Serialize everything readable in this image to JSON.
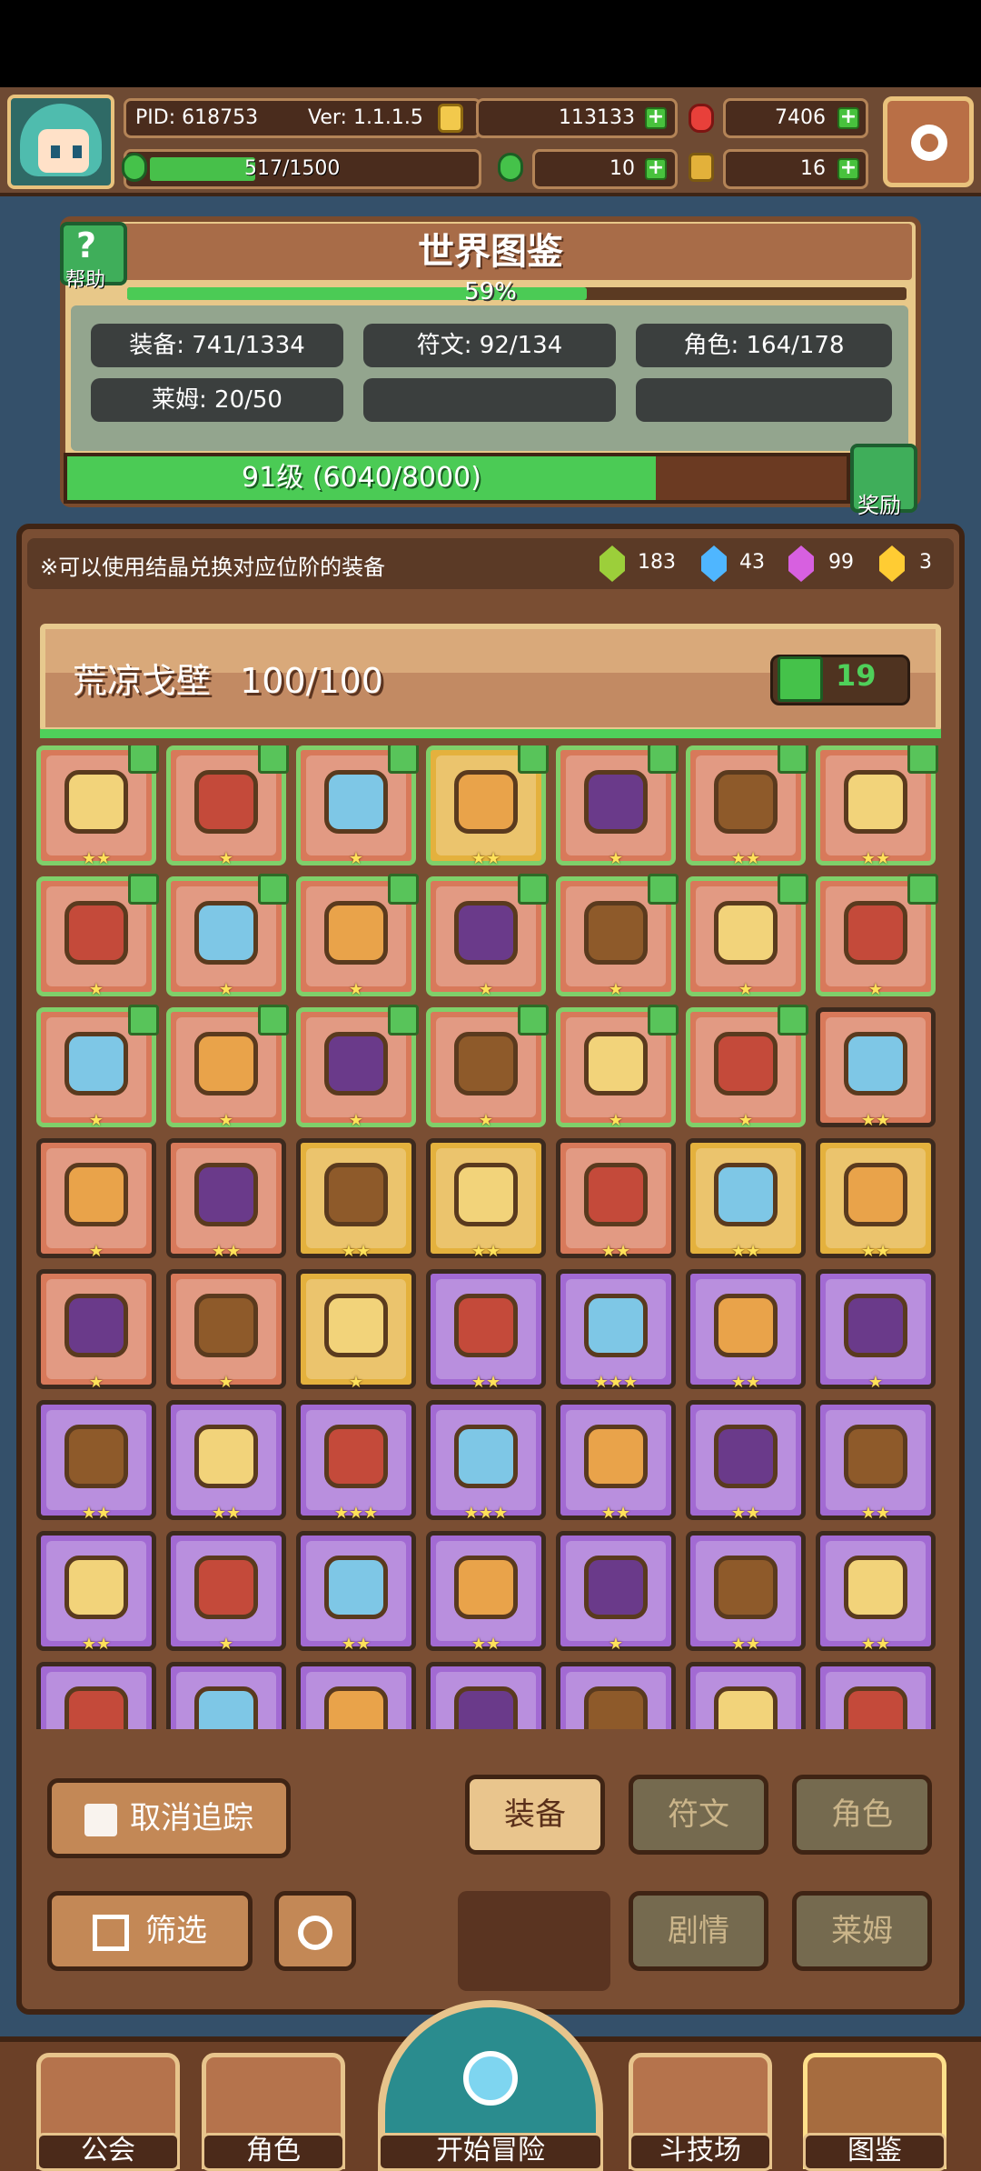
{
  "topbar": {
    "pid": "PID: 618753",
    "version": "Ver: 1.1.1.5",
    "gold": "113133",
    "gems": "7406",
    "energy": "517/1500",
    "energy_progress": 0.345,
    "clover": "10",
    "keys": "16"
  },
  "header": {
    "title": "世界图鉴",
    "help_label": "帮助",
    "progress_text": "59%",
    "progress": 0.59,
    "stats": {
      "equipment": "装备: 741/1334",
      "runes": "符文: 92/134",
      "characters": "角色: 164/178",
      "slime": "莱姆: 20/50"
    },
    "level_text": "91级 (6040/8000)",
    "level_progress": 0.755,
    "reward_label": "奖励"
  },
  "tip": {
    "text": "※可以使用结晶兑换对应位阶的装备",
    "crystals": [
      {
        "icon": "green-crystal-icon",
        "count": "183",
        "color": "#9ccf3a"
      },
      {
        "icon": "blue-crystal-icon",
        "count": "43",
        "color": "#4fb6ff"
      },
      {
        "icon": "purple-crystal-icon",
        "count": "99",
        "color": "#d760e0"
      },
      {
        "icon": "gold-crystal-icon",
        "count": "3",
        "color": "#ffcc33"
      }
    ]
  },
  "zone": {
    "name": "荒凉戈壁",
    "count": "100/100",
    "likes": "19"
  },
  "grid": [
    {
      "color": "orange",
      "ok": true,
      "stars": "★★",
      "icon": "heart-necklace-icon"
    },
    {
      "color": "orange",
      "ok": true,
      "stars": "★",
      "icon": "glove-icon"
    },
    {
      "color": "orange",
      "ok": true,
      "stars": "★",
      "icon": "ring-icon"
    },
    {
      "color": "gold",
      "ok": true,
      "stars": "★★",
      "icon": "heart-necklace-icon"
    },
    {
      "color": "orange",
      "ok": true,
      "stars": "★",
      "icon": "sceptre-icon"
    },
    {
      "color": "orange",
      "ok": true,
      "stars": "★★",
      "icon": "armor-icon"
    },
    {
      "color": "orange",
      "ok": true,
      "stars": "★★",
      "icon": "bow-armor-icon"
    },
    {
      "color": "orange",
      "ok": true,
      "stars": "★",
      "icon": "mace-icon"
    },
    {
      "color": "orange",
      "ok": true,
      "stars": "★",
      "icon": "crown-icon"
    },
    {
      "color": "orange",
      "ok": true,
      "stars": "★",
      "icon": "chestplate-icon"
    },
    {
      "color": "orange",
      "ok": true,
      "stars": "★",
      "icon": "gem-cross-icon"
    },
    {
      "color": "orange",
      "ok": true,
      "stars": "★",
      "icon": "necklace-icon"
    },
    {
      "color": "orange",
      "ok": true,
      "stars": "★",
      "icon": "winged-ring-icon"
    },
    {
      "color": "orange",
      "ok": true,
      "stars": "★",
      "icon": "bracer-icon"
    },
    {
      "color": "orange",
      "ok": true,
      "stars": "★",
      "icon": "feather-icon"
    },
    {
      "color": "orange",
      "ok": true,
      "stars": "★",
      "icon": "shield-icon"
    },
    {
      "color": "orange",
      "ok": true,
      "stars": "★",
      "icon": "amulet-icon"
    },
    {
      "color": "orange",
      "ok": true,
      "stars": "★",
      "icon": "wreath-icon"
    },
    {
      "color": "orange",
      "ok": true,
      "stars": "★",
      "icon": "ruby-ring-icon"
    },
    {
      "color": "orange",
      "ok": true,
      "stars": "★",
      "icon": "sword-icon"
    },
    {
      "color": "orange",
      "ok": false,
      "stars": "★★",
      "icon": "hood-icon"
    },
    {
      "color": "orange",
      "ok": false,
      "stars": "★",
      "icon": "boot-icon"
    },
    {
      "color": "orange",
      "ok": false,
      "stars": "★★",
      "icon": "spear-icon"
    },
    {
      "color": "gold",
      "ok": false,
      "stars": "★★",
      "icon": "band-ring-icon"
    },
    {
      "color": "gold",
      "ok": false,
      "stars": "★★",
      "icon": "flower-gem-icon"
    },
    {
      "color": "orange",
      "ok": false,
      "stars": "★★",
      "icon": "arrow-icon"
    },
    {
      "color": "gold",
      "ok": false,
      "stars": "★★",
      "icon": "diamond-gem-icon"
    },
    {
      "color": "gold",
      "ok": false,
      "stars": "★★",
      "icon": "gold-ring-icon"
    },
    {
      "color": "orange",
      "ok": false,
      "stars": "★",
      "icon": "crossbow-icon"
    },
    {
      "color": "orange",
      "ok": false,
      "stars": "★",
      "icon": "vest-icon"
    },
    {
      "color": "gold",
      "ok": false,
      "stars": "★",
      "icon": "gauntlet-icon"
    },
    {
      "color": "purple",
      "ok": false,
      "stars": "★★",
      "icon": "pendant-icon"
    },
    {
      "color": "purple",
      "ok": false,
      "stars": "★★★",
      "icon": "breastplate-icon"
    },
    {
      "color": "purple",
      "ok": false,
      "stars": "★★",
      "icon": "boots-icon"
    },
    {
      "color": "purple",
      "ok": false,
      "stars": "★",
      "icon": "gun-icon"
    },
    {
      "color": "purple",
      "ok": false,
      "stars": "★★",
      "icon": "boot-icon"
    },
    {
      "color": "purple",
      "ok": false,
      "stars": "★★",
      "icon": "belt-icon"
    },
    {
      "color": "purple",
      "ok": false,
      "stars": "★★★",
      "icon": "helmet-icon"
    },
    {
      "color": "purple",
      "ok": false,
      "stars": "★★★",
      "icon": "plate-armor-icon"
    },
    {
      "color": "purple",
      "ok": false,
      "stars": "★★",
      "icon": "greave-icon"
    },
    {
      "color": "purple",
      "ok": false,
      "stars": "★★",
      "icon": "gem-brooch-icon"
    },
    {
      "color": "purple",
      "ok": false,
      "stars": "★★",
      "icon": "heart-pendant-icon"
    },
    {
      "color": "purple",
      "ok": false,
      "stars": "★★",
      "icon": "jewel-ring-icon"
    },
    {
      "color": "purple",
      "ok": false,
      "stars": "★",
      "icon": "crystal-necklace-icon"
    },
    {
      "color": "purple",
      "ok": false,
      "stars": "★★",
      "icon": "pearl-ring-icon"
    },
    {
      "color": "purple",
      "ok": false,
      "stars": "★★",
      "icon": "star-gem-icon"
    },
    {
      "color": "purple",
      "ok": false,
      "stars": "★",
      "icon": "dagger-icon"
    },
    {
      "color": "purple",
      "ok": false,
      "stars": "★★",
      "icon": "orb-icon"
    },
    {
      "color": "purple",
      "ok": false,
      "stars": "★★",
      "icon": "heart-crystal-icon"
    },
    {
      "color": "purple",
      "ok": false,
      "stars": "",
      "icon": "star-amulet-icon"
    },
    {
      "color": "purple",
      "ok": false,
      "stars": "",
      "icon": "cloak-icon"
    },
    {
      "color": "purple",
      "ok": false,
      "stars": "",
      "icon": "knight-helmet-icon"
    },
    {
      "color": "purple",
      "ok": false,
      "stars": "",
      "icon": "cauldron-icon"
    },
    {
      "color": "purple",
      "ok": false,
      "stars": "",
      "icon": "dark-ring-icon"
    },
    {
      "color": "purple",
      "ok": false,
      "stars": "",
      "icon": "gold-boots-icon"
    },
    {
      "color": "purple",
      "ok": false,
      "stars": "",
      "icon": "ruby-brooch-icon"
    }
  ],
  "buttons": {
    "untrack": "取消追踪",
    "filter": "筛选",
    "equipment": "装备",
    "runes": "符文",
    "characters": "角色",
    "story": "剧情",
    "slime": "莱姆"
  },
  "nav": {
    "guild": "公会",
    "character": "角色",
    "start_adventure": "开始冒险",
    "arena": "斗技场",
    "codex": "图鉴"
  },
  "colors": {
    "orange_cell": "#d8795a",
    "gold_cell": "#e4b13d",
    "purple_cell": "#a26ad3",
    "owned_border": "#7fd06a",
    "progress_green": "#4bcb55"
  }
}
